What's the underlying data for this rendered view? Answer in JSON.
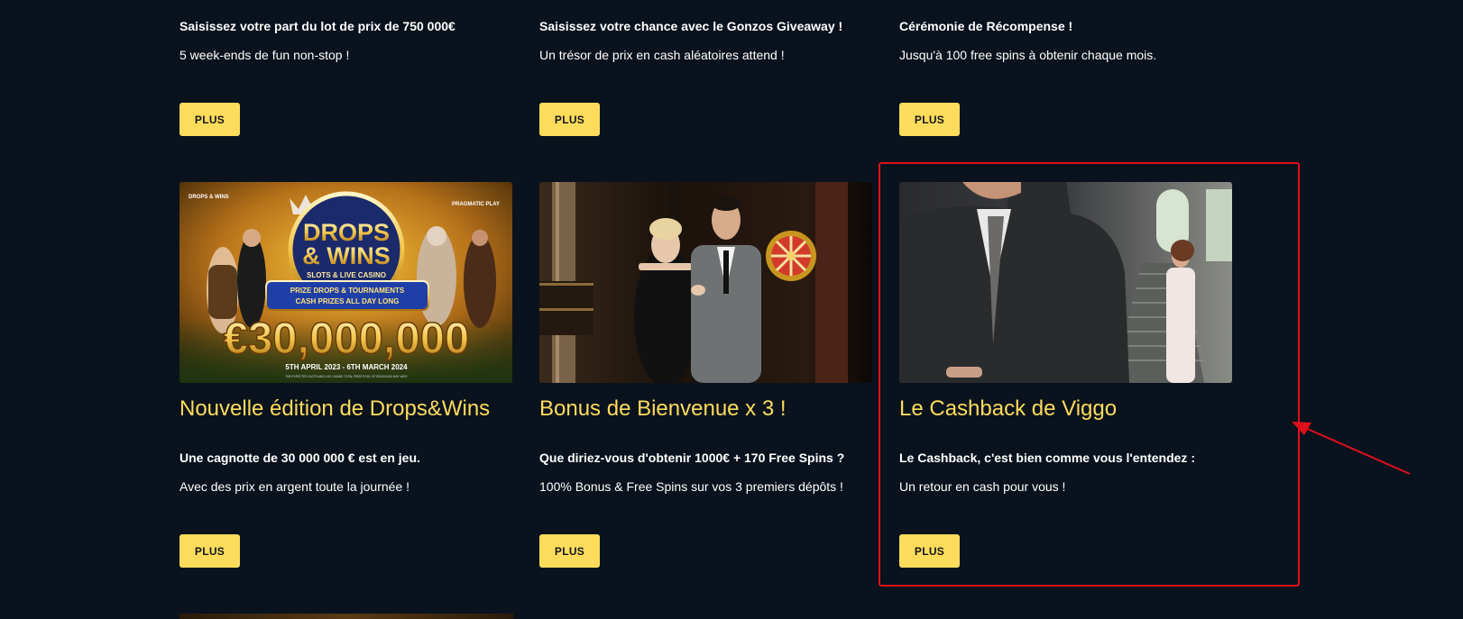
{
  "promotions_row_1": [
    {
      "subhead": "Saisissez votre part du lot de prix de 750 000€",
      "description": "5 week-ends de fun non-stop !",
      "button": "PLUS"
    },
    {
      "subhead": "Saisissez votre chance avec le Gonzos Giveaway !",
      "description": "Un trésor de prix en cash aléatoires attend !",
      "button": "PLUS"
    },
    {
      "subhead": "Cérémonie de Récompense !",
      "description": "Jusqu'à 100 free spins à obtenir chaque mois.",
      "button": "PLUS"
    }
  ],
  "promotions_row_2": [
    {
      "image": {
        "badge": "DROPS & WINS",
        "provider": "PRAGMATIC PLAY",
        "headline_1": "DROPS",
        "headline_2": "& WINS",
        "tagline": "SLOTS & LIVE CASINO",
        "banner_1": "PRIZE DROPS & TOURNAMENTS",
        "banner_2": "CASH PRIZES ALL DAY LONG",
        "amount": "€30,000,000",
        "dates": "5TH APRIL 2023 - 6TH MARCH 2024",
        "fine_print": "THE EXPECTED SLOTS AND LIVE CASINO TOTAL PRIZE POOL OF €30,000,000 MAY VARY"
      },
      "title": "Nouvelle édition de Drops&Wins",
      "subhead": "Une cagnotte de 30 000 000 € est en jeu.",
      "description": "Avec des prix en argent toute la journée !",
      "button": "PLUS"
    },
    {
      "title": "Bonus de Bienvenue x 3 !",
      "subhead": "Que diriez-vous d'obtenir 1000€ + 170 Free Spins ?",
      "description": "100% Bonus & Free Spins sur vos 3 premiers dépôts !",
      "button": "PLUS"
    },
    {
      "title": "Le Cashback de Viggo",
      "subhead": "Le Cashback, c'est bien comme vous l'entendez :",
      "description": "Un retour en cash pour vous !",
      "button": "PLUS"
    }
  ],
  "colors": {
    "background": "#0a121d",
    "accent_yellow": "#fddc5c",
    "highlight_red": "#e0101a"
  }
}
